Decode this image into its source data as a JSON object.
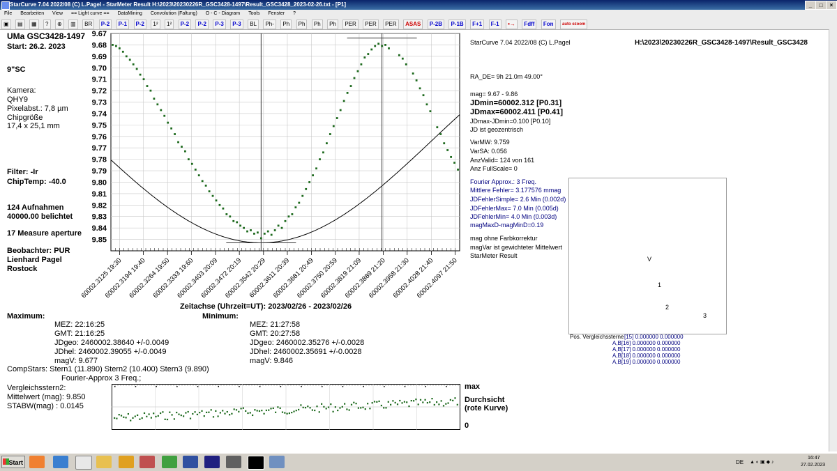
{
  "window": {
    "title": "StarCurve 7.04   2022/08  (C) L.Pagel - StarMeter Result  H:\\2023\\20230226R_GSC3428-1497\\Result_GSC3428_2023-02-26.txt - [P1]",
    "controls": [
      "_",
      "□",
      "×"
    ]
  },
  "menu": [
    "File",
    "Bearbeiten",
    "View",
    "== Light curve ==",
    "DataMining",
    "Convolution (Faltung)",
    "O - C - Diagram",
    "Tools",
    "Fenster",
    "?"
  ],
  "toolbar": {
    "buttons": [
      "BR",
      "P-1",
      "P-2",
      "P-3",
      "BL",
      "Ph-",
      "Ph",
      "Ph",
      "Ph",
      "Ph",
      "PER",
      "PER",
      "PER",
      "ASAS"
    ],
    "blue_buttons": [
      "P-2",
      "P-1",
      "P-2",
      "1²",
      "1²",
      "P-2",
      "P-2",
      "P-3",
      "P-3"
    ],
    "right_buttons": [
      "P-2B",
      "P-1B",
      "F+1",
      "F-1",
      "Fdff",
      "Fon",
      "auto ezoom"
    ]
  },
  "left_panel": {
    "star": "UMa GSC3428-1497",
    "start": "Start: 26.2. 2023",
    "telescope": "9\"SC",
    "kamera_label": "Kamera:",
    "kamera": "QHY9",
    "pixel": "Pixelabst.: 7,8 µm",
    "chip_label": "Chipgröße",
    "chip": "17,4 x 25,1 mm",
    "filter": "Filter: -Ir",
    "chiptemp": "ChipTemp: -40.0",
    "aufnahmen": "124 Aufnahmen",
    "belichtet": "40000.00 belichtet",
    "aperture": "17 Measure aperture",
    "beobachter": "Beobachter:  PUR",
    "name": "Lienhard Pagel",
    "city": "Rostock"
  },
  "chart_data": {
    "type": "scatter",
    "title": "",
    "xlabel": "Zeitachse (Uhrzeit=UT):   2023/02/26   -   2023/02/26",
    "ylabel": "",
    "ylim": [
      9.67,
      9.86
    ],
    "y_inverted": true,
    "xlim": [
      60002.31,
      60002.411
    ],
    "yticks": [
      "9.67",
      "9.68",
      "9.69",
      "9.70",
      "9.71",
      "9.72",
      "9.73",
      "9.74",
      "9.75",
      "9.76",
      "9.77",
      "9.78",
      "9.79",
      "9.80",
      "9.81",
      "9.82",
      "9.83",
      "9.84",
      "9.85"
    ],
    "xticks": [
      {
        "x": 60002.3125,
        "label": "60002.3125  19:30"
      },
      {
        "x": 60002.3194,
        "label": "60002.3194  19:40"
      },
      {
        "x": 60002.3264,
        "label": "60002.3264  19:50"
      },
      {
        "x": 60002.3333,
        "label": "60002.3333  19:60"
      },
      {
        "x": 60002.3403,
        "label": "60002.3403  20:09"
      },
      {
        "x": 60002.3472,
        "label": "60002.3472  20:19"
      },
      {
        "x": 60002.3542,
        "label": "60002.3542  20:29"
      },
      {
        "x": 60002.3611,
        "label": "60002.3611  20:39"
      },
      {
        "x": 60002.3681,
        "label": "60002.3681  20:49"
      },
      {
        "x": 60002.375,
        "label": "60002.3750  20:59"
      },
      {
        "x": 60002.3819,
        "label": "60002.3819  21:09"
      },
      {
        "x": 60002.3889,
        "label": "60002.3889  21:20"
      },
      {
        "x": 60002.3958,
        "label": "60002.3958  21:30"
      },
      {
        "x": 60002.4028,
        "label": "60002.4028  21:40"
      },
      {
        "x": 60002.4097,
        "label": "60002.4097  21:50"
      }
    ],
    "fourier": {
      "mean": 9.7635,
      "amp": 0.0895,
      "period": 0.198,
      "tmin": 60002.3535,
      "jdmin": 60002.312,
      "jdmax": 60002.411
    },
    "vlines": [
      60002.3535,
      60002.3885
    ],
    "grid": true,
    "series": [
      {
        "values": [
          [
            60002.3105,
            9.68
          ],
          [
            60002.3115,
            9.681
          ],
          [
            60002.3125,
            9.683
          ],
          [
            60002.3135,
            9.686
          ],
          [
            60002.3145,
            9.69
          ],
          [
            60002.3155,
            9.693
          ],
          [
            60002.3165,
            9.697
          ],
          [
            60002.3175,
            9.701
          ],
          [
            60002.3185,
            9.706
          ],
          [
            60002.3195,
            9.71
          ],
          [
            60002.3205,
            9.716
          ],
          [
            60002.3215,
            9.72
          ],
          [
            60002.3225,
            9.727
          ],
          [
            60002.3235,
            9.732
          ],
          [
            60002.3245,
            9.737
          ],
          [
            60002.3255,
            9.742
          ],
          [
            60002.3265,
            9.748
          ],
          [
            60002.3275,
            9.753
          ],
          [
            60002.3285,
            9.758
          ],
          [
            60002.3295,
            9.765
          ],
          [
            60002.3305,
            9.769
          ],
          [
            60002.3315,
            9.773
          ],
          [
            60002.3325,
            9.78
          ],
          [
            60002.3335,
            9.784
          ],
          [
            60002.3345,
            9.789
          ],
          [
            60002.3355,
            9.794
          ],
          [
            60002.3365,
            9.799
          ],
          [
            60002.3375,
            9.803
          ],
          [
            60002.3385,
            9.808
          ],
          [
            60002.3395,
            9.812
          ],
          [
            60002.3405,
            9.816
          ],
          [
            60002.3415,
            9.82
          ],
          [
            60002.3425,
            9.823
          ],
          [
            60002.3435,
            9.828
          ],
          [
            60002.3445,
            9.83
          ],
          [
            60002.3455,
            9.834
          ],
          [
            60002.3465,
            9.835
          ],
          [
            60002.3475,
            9.838
          ],
          [
            60002.3485,
            9.84
          ],
          [
            60002.3495,
            9.843
          ],
          [
            60002.3505,
            9.842
          ],
          [
            60002.3515,
            9.845
          ],
          [
            60002.3525,
            9.844
          ],
          [
            60002.3535,
            9.849
          ],
          [
            60002.3545,
            9.845
          ],
          [
            60002.3555,
            9.843
          ],
          [
            60002.3565,
            9.846
          ],
          [
            60002.3575,
            9.842
          ],
          [
            60002.3585,
            9.838
          ],
          [
            60002.3595,
            9.84
          ],
          [
            60002.3605,
            9.834
          ],
          [
            60002.3615,
            9.83
          ],
          [
            60002.3625,
            9.828
          ],
          [
            60002.3635,
            9.822
          ],
          [
            60002.3645,
            9.818
          ],
          [
            60002.3655,
            9.812
          ],
          [
            60002.3665,
            9.806
          ],
          [
            60002.3675,
            9.8
          ],
          [
            60002.3685,
            9.794
          ],
          [
            60002.3695,
            9.788
          ],
          [
            60002.3705,
            9.78
          ],
          [
            60002.3715,
            9.774
          ],
          [
            60002.3725,
            9.766
          ],
          [
            60002.3735,
            9.758
          ],
          [
            60002.3745,
            9.751
          ],
          [
            60002.3755,
            9.744
          ],
          [
            60002.3765,
            9.737
          ],
          [
            60002.3775,
            9.729
          ],
          [
            60002.3785,
            9.722
          ],
          [
            60002.3795,
            9.716
          ],
          [
            60002.3805,
            9.709
          ],
          [
            60002.3815,
            9.703
          ],
          [
            60002.3825,
            9.697
          ],
          [
            60002.3835,
            9.691
          ],
          [
            60002.3845,
            9.688
          ],
          [
            60002.3855,
            9.684
          ],
          [
            60002.3865,
            9.681
          ],
          [
            60002.3875,
            9.679
          ],
          [
            60002.3885,
            9.681
          ],
          [
            60002.3895,
            9.68
          ],
          [
            60002.3905,
            9.683
          ],
          [
            60002.3935,
            9.689
          ],
          [
            60002.3945,
            9.692
          ],
          [
            60002.3955,
            9.697
          ],
          [
            60002.3975,
            9.705
          ],
          [
            60002.3985,
            9.711
          ],
          [
            60002.3995,
            9.718
          ],
          [
            60002.4005,
            9.724
          ],
          [
            60002.4015,
            9.732
          ],
          [
            60002.4025,
            9.738
          ],
          [
            60002.4045,
            9.752
          ],
          [
            60002.4055,
            9.758
          ],
          [
            60002.4065,
            9.766
          ],
          [
            60002.4075,
            9.772
          ],
          [
            60002.4085,
            9.778
          ],
          [
            60002.4095,
            9.783
          ],
          [
            60002.4105,
            9.789
          ]
        ]
      }
    ]
  },
  "bottom_left": {
    "maximum_label": "Maximum:",
    "minimum_label": "Minimum:",
    "max_mez": "MEZ:    22:16:25",
    "max_gmt": "GMT:    21:16:25",
    "max_jdgeo": "JDgeo:  2460002.38640    +/-0.0049",
    "max_jdhel": "JDhel:  2460002.39055   +/-0.0049",
    "max_magv": "magV:         9.677",
    "min_mez": "MEZ:    21:27:58",
    "min_gmt": "GMT:    20:27:58",
    "min_jdgeo": "JDgeo:  2460002.35276    +/-0.0028",
    "min_jdhel": "JDhel:  2460002.35691   +/-0.0028",
    "min_magv": "magV:          9.846",
    "compstars": "CompStars: Stern1 (11.890) Stern2 (10.400) Stern3 (9.890)",
    "fourier": "Fourier-Approx 3 Freq.;",
    "vgl": "Vergleichsstern2:",
    "mittelwert": "Mittelwert (mag):  9.850",
    "stabw": "STABW(mag)    :  0.0145"
  },
  "mini_plot": {
    "max": "max",
    "durchsicht": "Durchsicht",
    "rote": "(rote Kurve)",
    "zero": "0"
  },
  "right_panel": {
    "header": "StarCurve 7.04   2022/08  (C) L.Pagel",
    "path": "H:\\2023\\20230226R_GSC3428-1497\\Result_GSC3428",
    "radec": "RA_DE= 9h 21.0m 49.00°",
    "mag": "mag= 9.67 -  9.86",
    "jdmin": "JDmin=60002.312 [P0.31]",
    "jdmax": "JDmax=60002.411 [P0.41]",
    "jddiff": "JDmax-JDmin=0.100 [P0.10]",
    "geo": "JD ist geozentrisch",
    "varmw": "VarMW: 9.759",
    "varsa": "VarSA: 0.056",
    "anzvalid": "AnzValid= 124 von 161",
    "anzfull": "Anz FullScale= 0",
    "fourier_freq": "Fourier Approx.: 3 Freq.",
    "mittl": "Mittlere Fehler= 3.177576 mmag",
    "jdsimple": "JDFehlerSimple=   2.6 Min (0.002d)",
    "jdmaxerr": "JDFehlerMax=   7.0 Min (0.005d)",
    "jdminerr": "JDFehlerMin=   4.0 Min (0.003d)",
    "magmaxd": "magMaxD-magMinD=0.19",
    "farb": "mag ohne Farbkorrektur",
    "magvar": "magVar ist gewichteter Mittelwert",
    "result": "StarMeter Result",
    "field_v": "V",
    "field_1": "1",
    "field_2": "2",
    "field_3": "3",
    "pos": "Pos. Vergleichssterne",
    "ab15": "[15] 0.000000 0.000000",
    "ab16": "A,B[16] 0.000000 0.000000",
    "ab17": "A,B[17] 0.000000 0.000000",
    "ab18": "A,B[18] 0.000000 0.000000",
    "ab19": "A,B[19] 0.000000 0.000000"
  },
  "taskbar": {
    "start": "Start",
    "lang": "DE",
    "time": "16:47",
    "date": "27.02.2023"
  }
}
